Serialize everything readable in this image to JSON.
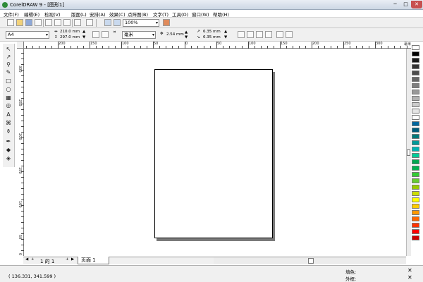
{
  "window": {
    "title": "CorelDRAW 9 - [图形1]",
    "minimize": "─",
    "maximize": "□",
    "close": "✕"
  },
  "menu": [
    "文件(F)",
    "编辑(E)",
    "检视(V)",
    "版面(L)",
    "安排(A)",
    "效果(C)",
    "点阵图(B)",
    "文字(T)",
    "工具(O)",
    "窗口(W)",
    "帮助(H)"
  ],
  "toolbar": {
    "zoom_value": "100%"
  },
  "property_bar": {
    "paper_size": "A4",
    "width": "210.0 mm",
    "height": "297.0 mm",
    "units": "毫米",
    "nudge": "2.54 mm",
    "duplicate_x": "6.35 mm",
    "duplicate_y": "6.35 mm"
  },
  "ruler": {
    "top_labels": [
      "200",
      "150",
      "100",
      "50",
      "0",
      "50",
      "100",
      "150",
      "200",
      "250",
      "300",
      "毫米"
    ],
    "left_labels": [
      "300",
      "250",
      "200",
      "150",
      "100",
      "50",
      "0"
    ]
  },
  "toolbox": [
    "pick-tool",
    "shape-tool",
    "zoom-tool",
    "freehand-tool",
    "rectangle-tool",
    "ellipse-tool",
    "polygon-tool",
    "spiral-tool",
    "text-tool",
    "interactive-blend-tool",
    "eyedropper-tool",
    "outline-tool",
    "fill-tool",
    "interactive-fill-tool"
  ],
  "palette_colors": [
    "#ffffff",
    "#000000",
    "#191919",
    "#333333",
    "#4c4c4c",
    "#666666",
    "#7f7f7f",
    "#999999",
    "#b2b2b2",
    "#cccccc",
    "#e5e5e5",
    "#ffffff",
    "#00669e",
    "#005c7a",
    "#007a7a",
    "#009999",
    "#00b3b3",
    "#00cc99",
    "#00a651",
    "#00b050",
    "#33cc33",
    "#66cc33",
    "#99cc00",
    "#ccdd00",
    "#ffff00",
    "#ffcc00",
    "#ff9900",
    "#ff6600",
    "#ff3300",
    "#ff0000",
    "#cc0000"
  ],
  "page_tabs": {
    "page_count": "1 的 1",
    "tab_label": "页面 1"
  },
  "status": {
    "coordinates": "( 136.331, 341.599 )",
    "fill_label": "填色:",
    "outline_label": "外框:"
  }
}
